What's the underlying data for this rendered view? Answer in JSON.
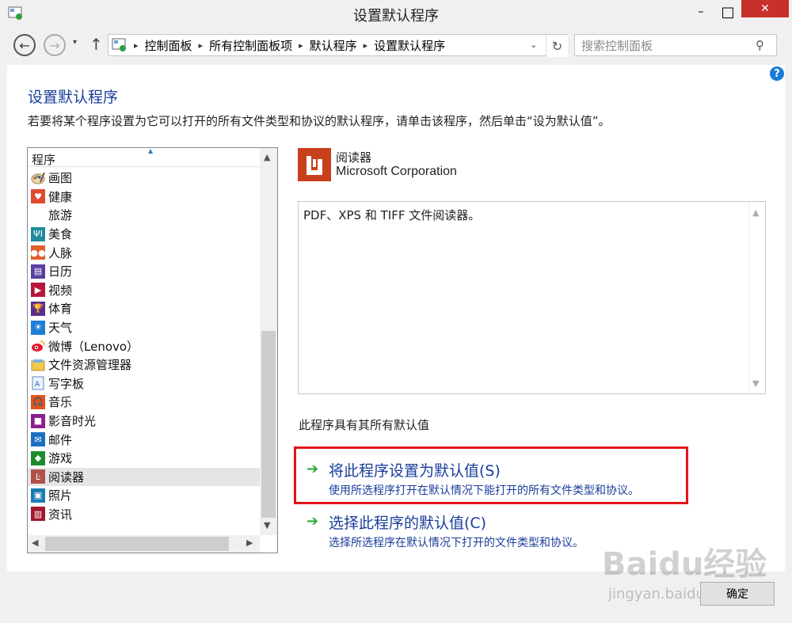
{
  "window": {
    "title": "设置默认程序",
    "minimize": "–",
    "maximize": "□",
    "close": "✕"
  },
  "nav": {
    "back": "←",
    "forward": "→",
    "dropdown": "▾",
    "up": "↑",
    "breadcrumbs": [
      "控制面板",
      "所有控制面板项",
      "默认程序",
      "设置默认程序"
    ],
    "separator": "▸",
    "address_dropdown": "⌄",
    "refresh": "↻",
    "search_placeholder": "搜索控制面板",
    "search_icon": "⚲"
  },
  "help_icon": "?",
  "heading": "设置默认程序",
  "description": "若要将某个程序设置为它可以打开的所有文件类型和协议的默认程序，请单击该程序，然后单击“设为默认值”。",
  "list": {
    "header": "程序",
    "items": [
      {
        "label": "画图",
        "icon": "paint-icon",
        "color": "#f0f0f0"
      },
      {
        "label": "健康",
        "icon": "health-icon",
        "color": "#e04a2f"
      },
      {
        "label": "旅游",
        "icon": "travel-icon",
        "color": "#ffffff"
      },
      {
        "label": "美食",
        "icon": "food-icon",
        "color": "#1f8a9e"
      },
      {
        "label": "人脉",
        "icon": "people-icon",
        "color": "#e05f2a"
      },
      {
        "label": "日历",
        "icon": "calendar-icon",
        "color": "#5a3fa0"
      },
      {
        "label": "视频",
        "icon": "video-icon",
        "color": "#b8163a"
      },
      {
        "label": "体育",
        "icon": "sports-icon",
        "color": "#5a2d8c"
      },
      {
        "label": "天气",
        "icon": "weather-icon",
        "color": "#1d7fd6"
      },
      {
        "label": "微博（Lenovo）",
        "icon": "weibo-icon",
        "color": "#ffffff"
      },
      {
        "label": "文件资源管理器",
        "icon": "explorer-icon",
        "color": "#f2c94c"
      },
      {
        "label": "写字板",
        "icon": "wordpad-icon",
        "color": "#8ab4e8"
      },
      {
        "label": "音乐",
        "icon": "music-icon",
        "color": "#e8501a"
      },
      {
        "label": "影音时光",
        "icon": "media-icon",
        "color": "#8b1e8e"
      },
      {
        "label": "邮件",
        "icon": "mail-icon",
        "color": "#1d6fc4"
      },
      {
        "label": "游戏",
        "icon": "games-icon",
        "color": "#1e8a2e"
      },
      {
        "label": "阅读器",
        "icon": "reader-icon",
        "color": "#b0524a",
        "selected": true
      },
      {
        "label": "照片",
        "icon": "photos-icon",
        "color": "#1a7bb5"
      },
      {
        "label": "资讯",
        "icon": "news-icon",
        "color": "#a3172d"
      }
    ],
    "scroll_up": "▲",
    "scroll_down": "▼",
    "scroll_left": "◀",
    "scroll_right": "▶"
  },
  "program": {
    "name": "阅读器",
    "publisher": "Microsoft Corporation",
    "description": "PDF、XPS 和 TIFF 文件阅读器。",
    "status": "此程序具有其所有默认值"
  },
  "actions": {
    "set_default_title": "将此程序设置为默认值(S)",
    "set_default_sub": "使用所选程序打开在默认情况下能打开的所有文件类型和协议。",
    "choose_defaults_title": "选择此程序的默认值(C)",
    "choose_defaults_sub": "选择所选程序在默认情况下打开的文件类型和协议。",
    "arrow": "➔"
  },
  "ok_button": "确定",
  "watermark": {
    "logo": "Baidu经验",
    "url": "jingyan.baidu.com"
  },
  "colors": {
    "heading": "#1a3d9b",
    "highlight_border": "#e3151b",
    "close_button": "#c7312c",
    "action_arrow": "#2bab35"
  }
}
